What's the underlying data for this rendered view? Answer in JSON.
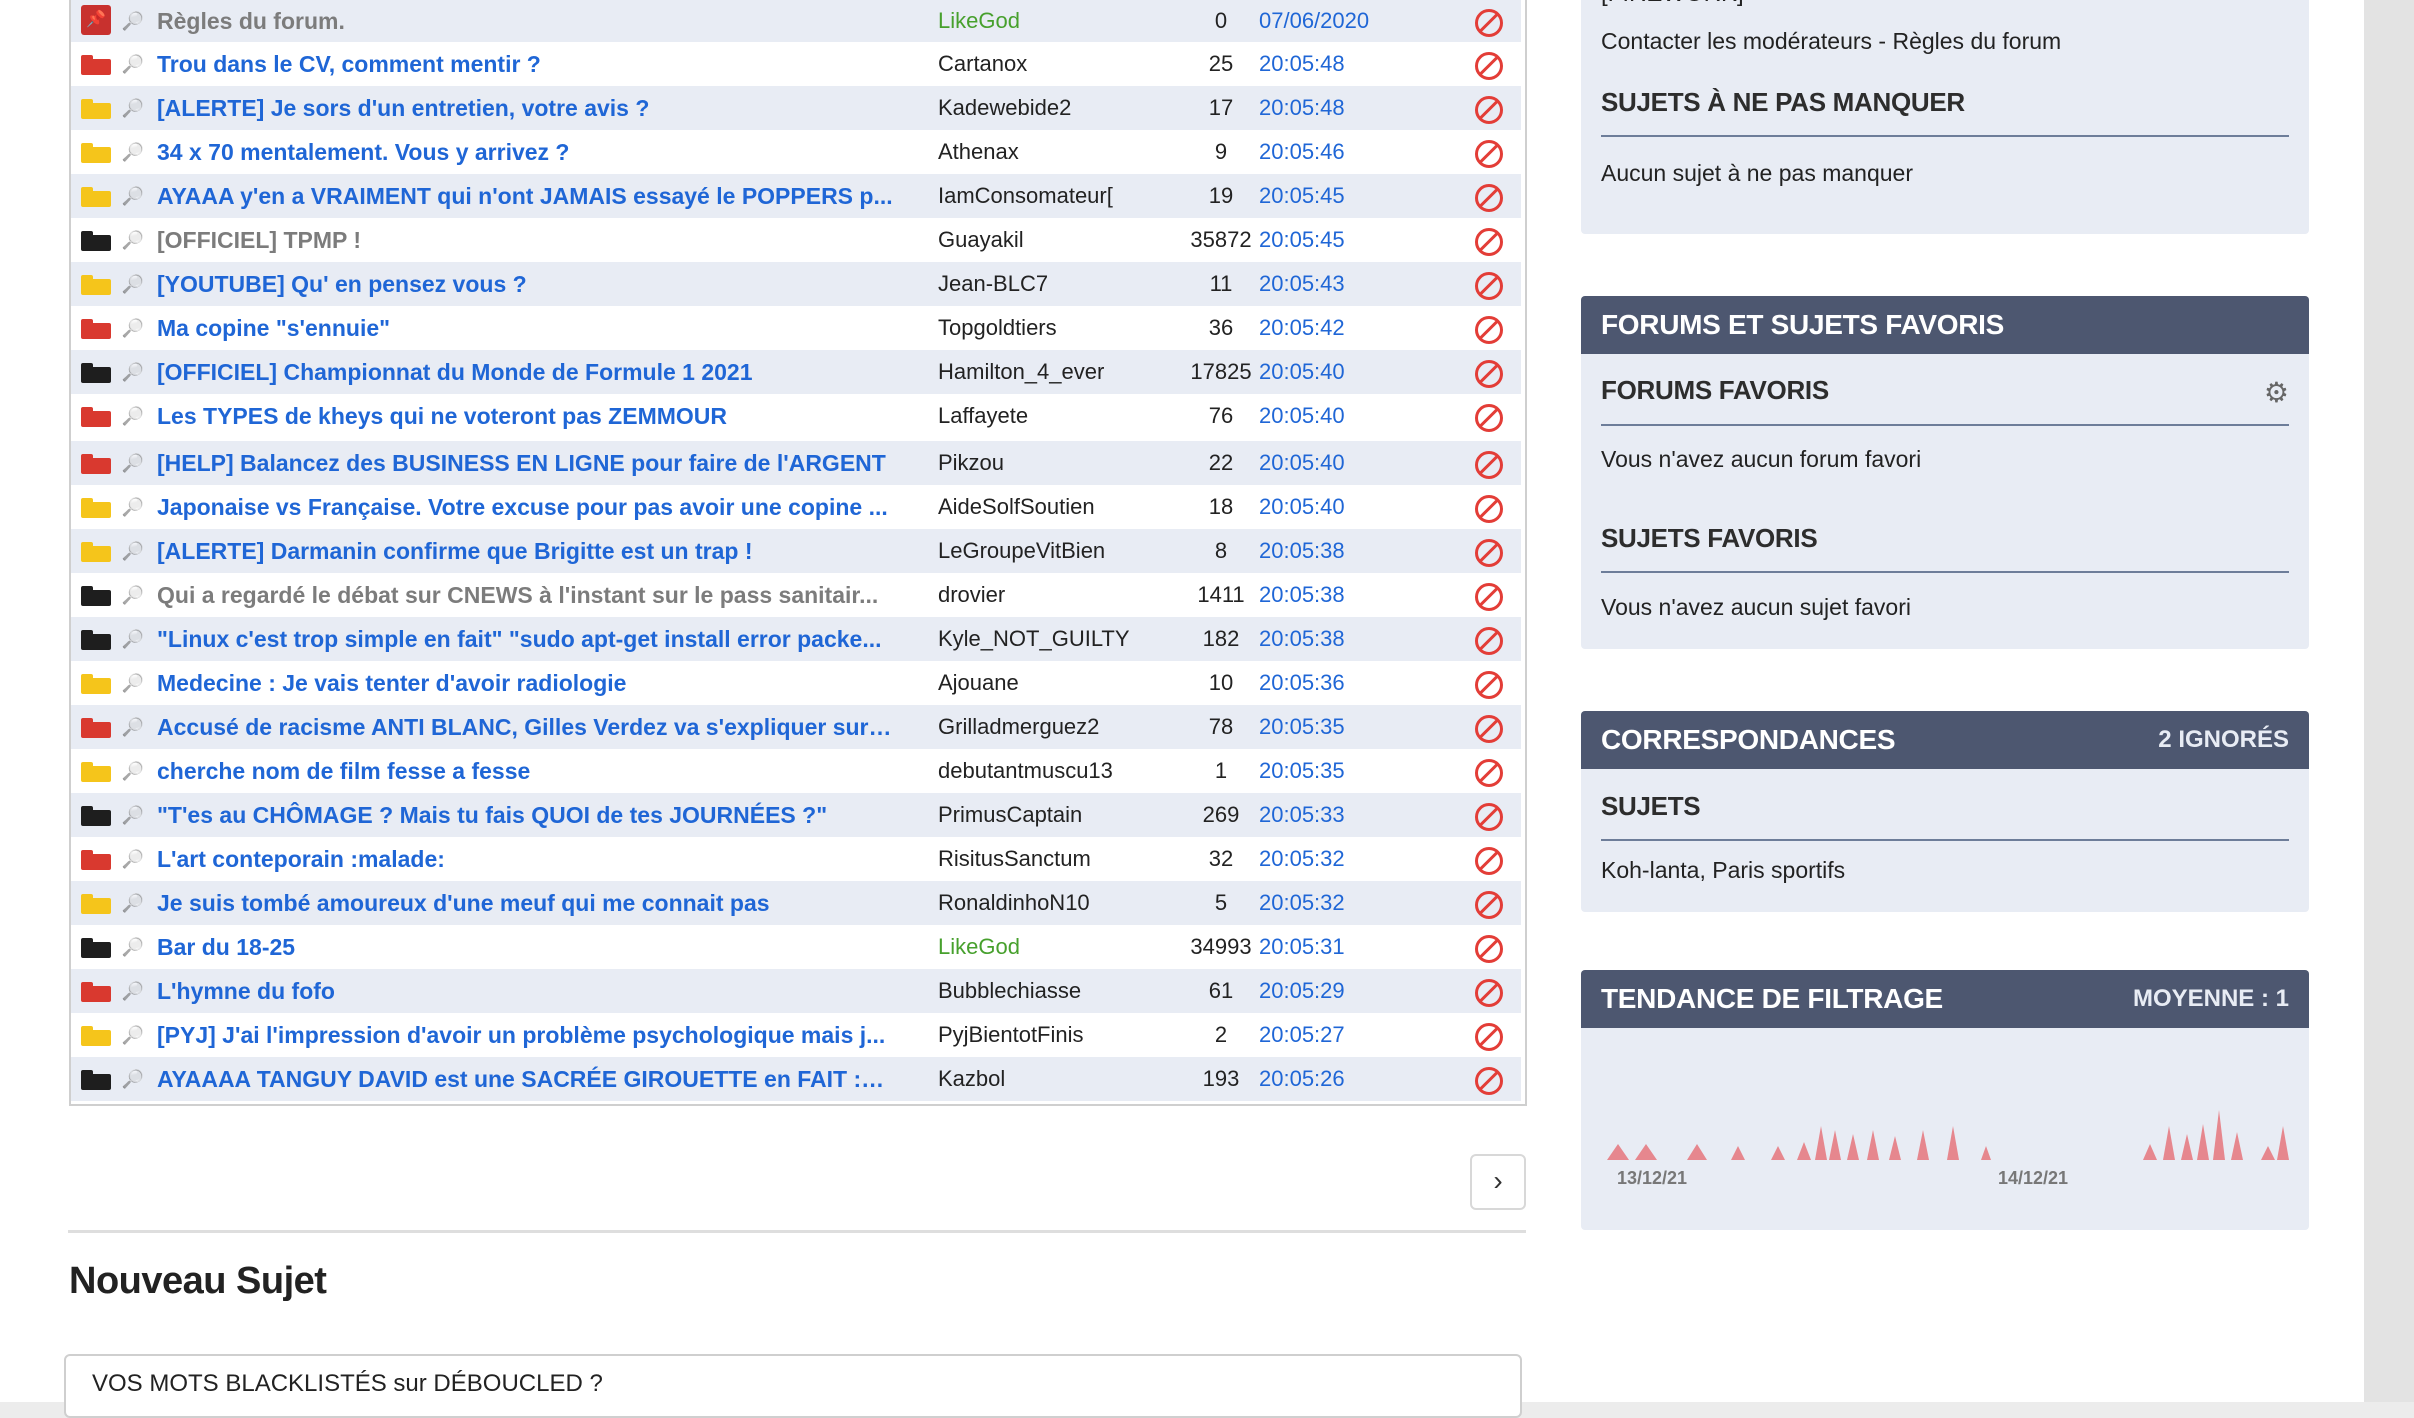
{
  "topics": [
    {
      "title": "Règles du forum.",
      "author": "LikeGod",
      "count": "0",
      "time": "07/06/2020",
      "folder": "pin",
      "title_color": "grey",
      "author_color": "green"
    },
    {
      "title": "Trou dans le CV, comment mentir ?",
      "author": "Cartanox",
      "count": "25",
      "time": "20:05:48",
      "folder": "red"
    },
    {
      "title": "[ALERTE] Je sors d'un entretien, votre avis ?",
      "author": "Kadewebide2",
      "count": "17",
      "time": "20:05:48",
      "folder": "yellow"
    },
    {
      "title": "34 x 70 mentalement. Vous y arrivez ?",
      "author": "Athenax",
      "count": "9",
      "time": "20:05:46",
      "folder": "yellow"
    },
    {
      "title": "AYAAA y'en a VRAIMENT qui n'ont JAMAIS essayé le POPPERS p...",
      "author": "IamConsomateur[",
      "count": "19",
      "time": "20:05:45",
      "folder": "yellow"
    },
    {
      "title": "[OFFICIEL] TPMP !",
      "author": "Guayakil",
      "count": "35872",
      "time": "20:05:45",
      "folder": "black",
      "title_color": "grey"
    },
    {
      "title": "[YOUTUBE] Qu' en pensez vous ?",
      "author": "Jean-BLC7",
      "count": "11",
      "time": "20:05:43",
      "folder": "yellow"
    },
    {
      "title": "Ma copine \"s'ennuie\"",
      "author": "Topgoldtiers",
      "count": "36",
      "time": "20:05:42",
      "folder": "red"
    },
    {
      "title": "[OFFICIEL] Championnat du Monde de Formule 1 2021",
      "author": "Hamilton_4_ever",
      "count": "17825",
      "time": "20:05:40",
      "folder": "black"
    },
    {
      "title": "Les TYPES de kheys qui ne voteront pas ZEMMOUR",
      "author": "Laffayete",
      "count": "76",
      "time": "20:05:40",
      "folder": "red"
    },
    {
      "title": "[HELP] Balancez des BUSINESS EN LIGNE pour faire de l'ARGENT",
      "author": "Pikzou",
      "count": "22",
      "time": "20:05:40",
      "folder": "red"
    },
    {
      "title": "Japonaise vs Française. Votre excuse pour pas avoir une copine ...",
      "author": "AideSolfSoutien",
      "count": "18",
      "time": "20:05:40",
      "folder": "yellow"
    },
    {
      "title": "[ALERTE] Darmanin confirme que Brigitte est un trap !",
      "author": "LeGroupeVitBien",
      "count": "8",
      "time": "20:05:38",
      "folder": "yellow"
    },
    {
      "title": "Qui a regardé le débat sur CNEWS à l'instant sur le pass sanitair...",
      "author": "drovier",
      "count": "1411",
      "time": "20:05:38",
      "folder": "black",
      "title_color": "grey"
    },
    {
      "title": "\"Linux c'est trop simple en fait\" \"sudo apt-get install error packe...",
      "author": "Kyle_NOT_GUILTY",
      "count": "182",
      "time": "20:05:38",
      "folder": "black"
    },
    {
      "title": "Medecine : Je vais tenter d'avoir radiologie",
      "author": "Ajouane",
      "count": "10",
      "time": "20:05:36",
      "folder": "yellow"
    },
    {
      "title": "Accusé de racisme ANTI BLANC, Gilles Verdez va s'expliquer sur ...",
      "author": "Grilladmerguez2",
      "count": "78",
      "time": "20:05:35",
      "folder": "red"
    },
    {
      "title": "cherche nom de film fesse a fesse",
      "author": "debutantmuscu13",
      "count": "1",
      "time": "20:05:35",
      "folder": "yellow"
    },
    {
      "title": "\"T'es au CHÔMAGE ? Mais tu fais QUOI de tes JOURNÉES ?\"",
      "author": "PrimusCaptain",
      "count": "269",
      "time": "20:05:33",
      "folder": "black"
    },
    {
      "title": "L'art conteporain :malade:",
      "author": "RisitusSanctum",
      "count": "32",
      "time": "20:05:32",
      "folder": "red"
    },
    {
      "title": "Je suis tombé amoureux d'une meuf qui me connait pas",
      "author": "RonaldinhoN10",
      "count": "5",
      "time": "20:05:32",
      "folder": "yellow"
    },
    {
      "title": "Bar du 18-25",
      "author": "LikeGod",
      "count": "34993",
      "time": "20:05:31",
      "folder": "black",
      "author_color": "green"
    },
    {
      "title": "L'hymne du fofo",
      "author": "Bubblechiasse",
      "count": "61",
      "time": "20:05:29",
      "folder": "red"
    },
    {
      "title": "[PYJ] J'ai l'impression d'avoir un problème psychologique mais j...",
      "author": "PyjBientotFinis",
      "count": "2",
      "time": "20:05:27",
      "folder": "yellow"
    },
    {
      "title": "AYAAAA TANGUY DAVID est une SACRÉE GIROUETTE en FAIT :ri...",
      "author": "Kazbol",
      "count": "193",
      "time": "20:05:26",
      "folder": "black"
    }
  ],
  "folder_colors": {
    "red": "#d9392f",
    "yellow": "#f5c51b",
    "black": "#1e1e1e"
  },
  "pagination": {
    "next_icon": "chevron-right-icon",
    "next_label": "›"
  },
  "new_topic": {
    "heading": "Nouveau Sujet",
    "input_value": "VOS MOTS BLACKLISTÉS sur DÉBOUCLED ?"
  },
  "sidebar": {
    "moderation": {
      "partial_title": "[FIREWORK]",
      "links": "Contacter les modérateurs - Règles du forum",
      "not_to_miss_title": "SUJETS À NE PAS MANQUER",
      "not_to_miss_text": "Aucun sujet à ne pas manquer"
    },
    "favorites": {
      "title": "FORUMS ET SUJETS FAVORIS",
      "forums_title": "FORUMS FAVORIS",
      "forums_text": "Vous n'avez aucun forum favori",
      "topics_title": "SUJETS FAVORIS",
      "topics_text": "Vous n'avez aucun sujet favori"
    },
    "correspondences": {
      "title": "CORRESPONDANCES",
      "ignored": "2 IGNORÉS",
      "subjects_title": "SUJETS",
      "subjects_text": "Koh-lanta,  Paris sportifs"
    },
    "filtering": {
      "title": "TENDANCE DE FILTRAGE",
      "average": "MOYENNE : 1",
      "date_left": "13/12/21",
      "date_right": "14/12/21",
      "color": "#e6878e"
    }
  }
}
